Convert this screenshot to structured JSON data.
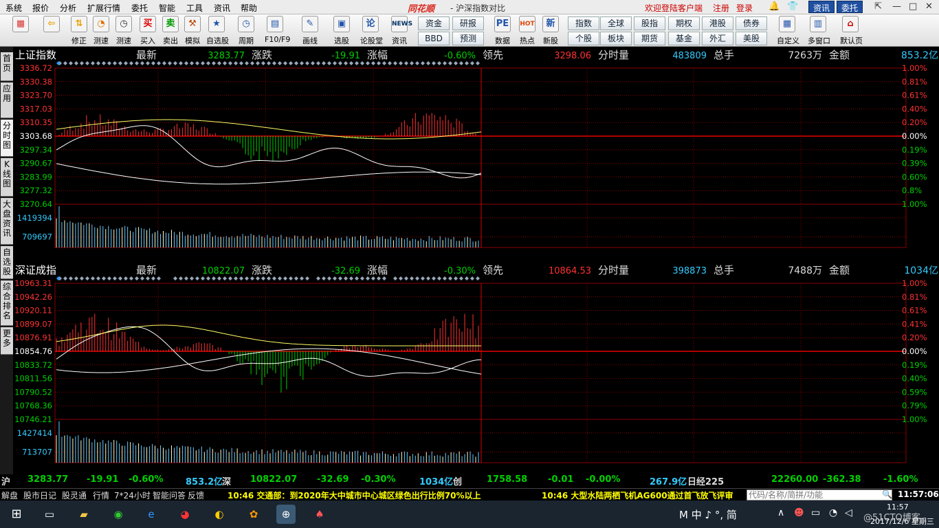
{
  "menu": {
    "items": [
      "系统",
      "报价",
      "分析",
      "扩展行情",
      "委托",
      "智能",
      "工具",
      "资讯",
      "帮助"
    ],
    "logo": "同花顺",
    "title": "- 沪深指数对比",
    "welcome": "欢迎登陆客户端",
    "register": "注册",
    "login": "登录",
    "btn_news": "资讯",
    "btn_trade": "委托"
  },
  "toolbar": {
    "icons": [
      {
        "label": "",
        "glyph": "▦",
        "color": "#d33"
      },
      {
        "label": "",
        "glyph": "⇦",
        "color": "#e8a000"
      },
      {
        "label": "修正",
        "glyph": "⇅",
        "color": "#e8a000"
      },
      {
        "label": "测速",
        "glyph": "◔",
        "color": "#e07000"
      },
      {
        "label": "测速",
        "glyph": "◷",
        "color": "#333"
      },
      {
        "label": "买入",
        "glyph": "买",
        "color": "#d00"
      },
      {
        "label": "卖出",
        "glyph": "卖",
        "color": "#090"
      },
      {
        "label": "模拟",
        "glyph": "⚒",
        "color": "#b40"
      },
      {
        "label": "自选股",
        "glyph": "★",
        "color": "#25a"
      },
      {
        "label": "周期",
        "glyph": "◷",
        "color": "#25a"
      },
      {
        "label": "F10/F9",
        "glyph": "▤",
        "color": "#25a"
      },
      {
        "label": "画线",
        "glyph": "✎",
        "color": "#25a"
      },
      {
        "label": "选股",
        "glyph": "▣",
        "color": "#25a"
      },
      {
        "label": "论股堂",
        "glyph": "论",
        "color": "#25a"
      },
      {
        "label": "资讯",
        "glyph": "NEWS",
        "color": "#036"
      },
      {
        "label": "数据",
        "glyph": "PE",
        "color": "#25a"
      },
      {
        "label": "热点",
        "glyph": "HOT",
        "color": "#d40"
      },
      {
        "label": "新股",
        "glyph": "新",
        "color": "#25a"
      },
      {
        "label": "自定义",
        "glyph": "▦",
        "color": "#25a"
      },
      {
        "label": "多窗口",
        "glyph": "▥",
        "color": "#25a"
      },
      {
        "label": "默认页",
        "glyph": "⌂",
        "color": "#c00"
      }
    ],
    "grid": [
      "资金",
      "研报",
      "BBD",
      "预测",
      "指数",
      "全球",
      "股指",
      "期权",
      "港股",
      "债券",
      "个股",
      "板块",
      "期货",
      "基金",
      "外汇",
      "美股"
    ]
  },
  "sidebar": [
    "首页",
    "应用",
    "分时图",
    "K线图",
    "大盘资讯",
    "自选股",
    "综合排名",
    "更多"
  ],
  "panels": [
    {
      "name": "上证指数",
      "new_label": "最新",
      "new": "3283.77",
      "chg_label": "涨跌",
      "chg": "-19.91",
      "pct_label": "涨幅",
      "pct": "-0.60%",
      "lead_label": "领先",
      "lead": "3298.06",
      "vol_label": "分时量",
      "vol": "483809",
      "hand_label": "总手",
      "hand": "7263万",
      "amt_label": "金额",
      "amt": "853.2亿",
      "left_axis": [
        "3336.72",
        "3330.38",
        "3323.70",
        "3317.03",
        "3310.35",
        "3303.68",
        "3297.34",
        "3290.67",
        "3283.99",
        "3277.32",
        "3270.64"
      ],
      "right_axis": [
        "1.00%",
        "0.81%",
        "0.61%",
        "0.40%",
        "0.20%",
        "0.00%",
        "0.19%",
        "0.39%",
        "0.60%",
        "0.8%",
        "1.00%"
      ],
      "vol_axis": [
        "1419394",
        "709697"
      ],
      "prev_close": 3303.68,
      "unit": 6.67
    },
    {
      "name": "深证成指",
      "new_label": "最新",
      "new": "10822.07",
      "chg_label": "涨跌",
      "chg": "-32.69",
      "pct_label": "涨幅",
      "pct": "-0.30%",
      "lead_label": "领先",
      "lead": "10864.53",
      "vol_label": "分时量",
      "vol": "398873",
      "hand_label": "总手",
      "hand": "7488万",
      "amt_label": "金额",
      "amt": "1034亿",
      "left_axis": [
        "10963.31",
        "10942.26",
        "10920.11",
        "10899.07",
        "10876.91",
        "10854.76",
        "10833.72",
        "10811.56",
        "10790.52",
        "10768.36",
        "10746.21"
      ],
      "right_axis": [
        "1.00%",
        "0.81%",
        "0.61%",
        "0.41%",
        "0.20%",
        "0.00%",
        "0.19%",
        "0.40%",
        "0.59%",
        "0.79%",
        "1.00%"
      ],
      "vol_axis": [
        "1427414",
        "713707"
      ],
      "prev_close": 10854.76,
      "unit": 21.7
    }
  ],
  "bottom": {
    "sh_label": "沪",
    "sh_price": "3283.77",
    "sh_chg": "-19.91",
    "sh_pct": "-0.60%",
    "sh_amt": "853.2亿",
    "sz_label": "深",
    "sz_price": "10822.07",
    "sz_chg": "-32.69",
    "sz_pct": "-0.30%",
    "sz_amt": "1034亿",
    "cy_label": "创",
    "cy_price": "1758.58",
    "cy_chg": "-0.01",
    "cy_pct": "-0.00%",
    "cy_amt": "267.9亿",
    "rj_label": "日经225",
    "rj_price": "22260.00",
    "rj_chg": "-362.38",
    "rj_pct": "-1.60%"
  },
  "status": {
    "items": [
      "解盘",
      "股市日记",
      "股灵通",
      "行情",
      "7*24小时",
      "智能问答",
      "反馈"
    ],
    "news1": "10:46 交通部：到2020年大中城市中心城区绿色出行比例70%以上",
    "news2": "10:46 大型水陆两栖飞机AG600通过首飞放飞评审",
    "search_placeholder": "代码/名称/简拼/功能",
    "time": "11:57:06"
  },
  "taskbar": {
    "ime": "M 中 ♪ °, 简",
    "clock_time": "11:57",
    "clock_date": "2017/12/6 星期三",
    "watermark": "@51CTO博客"
  },
  "colors": {
    "up": "#ff3232",
    "down": "#00d000",
    "price_line": "#ffffff",
    "avg_line": "#ffff66",
    "volume": "#66ccff",
    "grid": "#8b0000",
    "text_yellow": "#ffff00",
    "cyan": "#33ccff"
  }
}
